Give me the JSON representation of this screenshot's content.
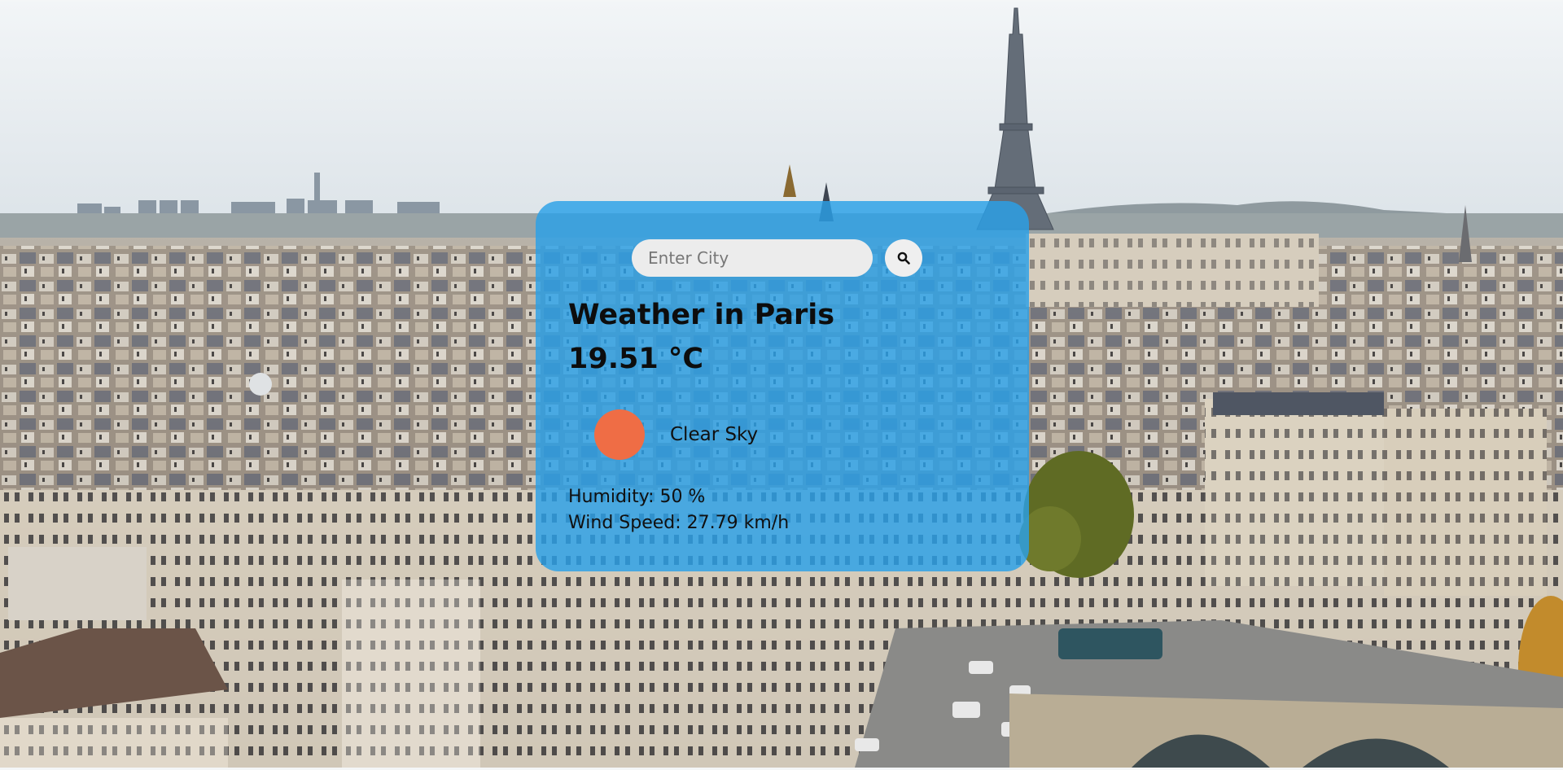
{
  "search": {
    "placeholder": "Enter City",
    "value": ""
  },
  "weather": {
    "title": "Weather in Paris",
    "temperature": "19.51 °C",
    "condition": "Clear Sky",
    "humidity": "Humidity: 50 %",
    "wind_speed": "Wind Speed: 27.79 km/h"
  },
  "icons": {
    "search": "search-icon",
    "weather": "sun-icon"
  },
  "colors": {
    "card_background": "#2aa0e8",
    "weather_icon": "#ef6d45",
    "input_background": "#ececec"
  }
}
